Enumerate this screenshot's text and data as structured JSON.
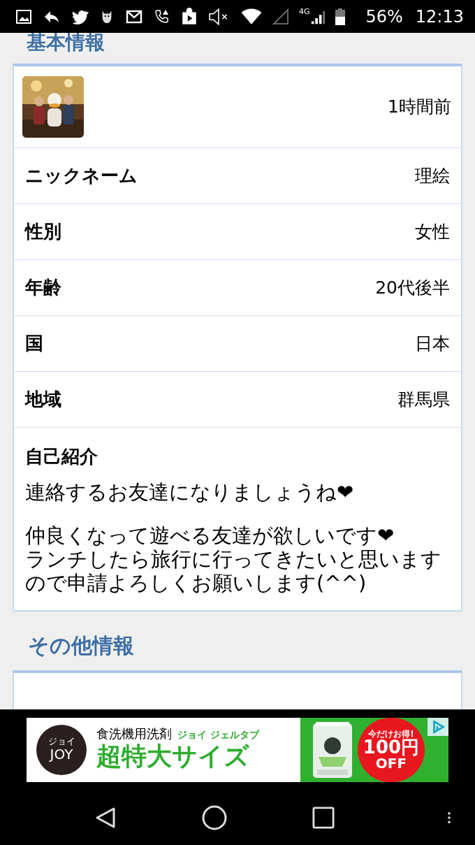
{
  "status_bar": {
    "network": "4G",
    "battery": "56%",
    "time": "12:13"
  },
  "sections": [
    {
      "heading": "基本情報",
      "updated": "1時間前",
      "rows": [
        {
          "label": "ニックネーム",
          "value": "理絵"
        },
        {
          "label": "性別",
          "value": "女性"
        },
        {
          "label": "年齢",
          "value": "20代後半"
        },
        {
          "label": "国",
          "value": "日本"
        },
        {
          "label": "地域",
          "value": "群馬県"
        }
      ],
      "intro": {
        "label": "自己紹介",
        "paragraphs": [
          "連絡するお友達になりましょうね❤",
          "仲良くなって遊べる友達が欲しいです❤\nランチしたら旅行に行ってきたいと思いますので申請よろしくお願いします(^^)"
        ]
      }
    },
    {
      "heading": "その他情報"
    }
  ],
  "ad": {
    "logo_kana": "ジョイ",
    "logo": "JOY",
    "category": "食洗機用洗剤",
    "product": "ジョイ ジェルタブ",
    "headline": "超特大サイズ",
    "promo": "今だけお得!",
    "discount": "100円",
    "off": "OFF"
  }
}
